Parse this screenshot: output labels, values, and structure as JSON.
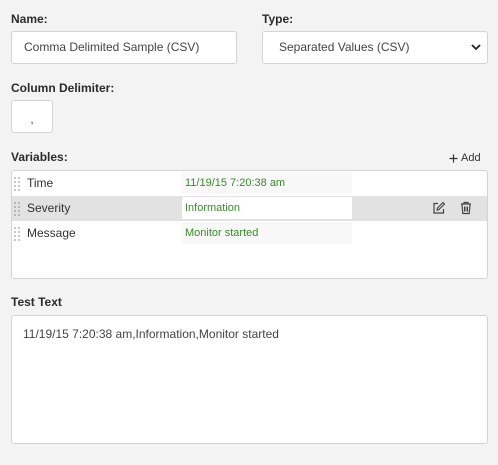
{
  "form": {
    "name_label": "Name:",
    "name_value": "Comma Delimited Sample (CSV)",
    "type_label": "Type:",
    "type_value": "Separated Values (CSV)",
    "delimiter_label": "Column Delimiter:",
    "delimiter_value": ",",
    "variables_label": "Variables:",
    "add_label": "Add",
    "test_text_label": "Test Text",
    "test_text_value": "11/19/15 7:20:38 am,Information,Monitor started"
  },
  "variables": [
    {
      "name": "Time",
      "value": "11/19/15 7:20:38 am"
    },
    {
      "name": "Severity",
      "value": "Information"
    },
    {
      "name": "Message",
      "value": "Monitor started"
    }
  ],
  "colors": {
    "value_text": "#3a8a2c",
    "selected_row": "#e2e2e2",
    "background": "#f3f3f3"
  }
}
